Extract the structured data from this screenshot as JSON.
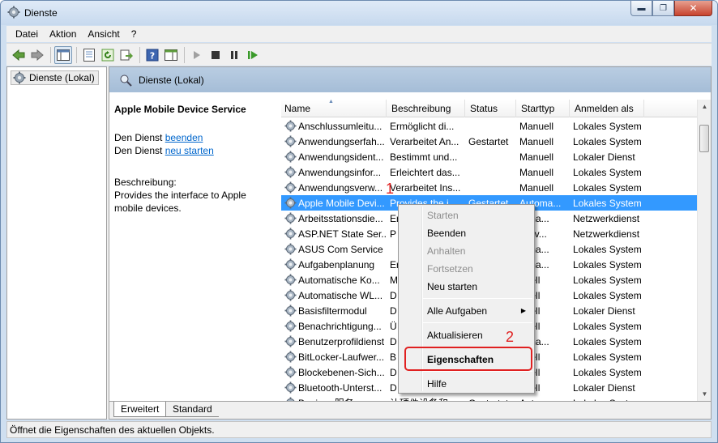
{
  "window": {
    "title": "Dienste",
    "min_icon": "minimize-icon",
    "max_icon": "maximize-icon",
    "close_icon": "close-icon"
  },
  "menubar": [
    "Datei",
    "Aktion",
    "Ansicht",
    "?"
  ],
  "toolbar": {
    "icons": [
      "back-icon",
      "forward-icon",
      "console-tree-icon",
      "properties-icon",
      "refresh-icon",
      "export-icon",
      "help-icon",
      "show-hide-icon",
      "start-icon",
      "stop-icon",
      "pause-icon",
      "restart-icon"
    ]
  },
  "tree": {
    "item": "Dienste (Lokal)"
  },
  "header": {
    "title": "Dienste (Lokal)"
  },
  "details": {
    "service_name": "Apple Mobile Device Service",
    "stop_prefix": "Den Dienst ",
    "stop_link": "beenden",
    "restart_prefix": "Den Dienst ",
    "restart_link": "neu starten",
    "desc_label": "Beschreibung:",
    "desc_line1": "Provides the interface to Apple",
    "desc_line2": "mobile devices."
  },
  "columns": [
    "Name",
    "Beschreibung",
    "Status",
    "Starttyp",
    "Anmelden als"
  ],
  "rows": [
    [
      "Anschlussumleitu...",
      "Ermöglicht di...",
      "",
      "Manuell",
      "Lokales System"
    ],
    [
      "Anwendungserfah...",
      "Verarbeitet An...",
      "Gestartet",
      "Manuell",
      "Lokales System"
    ],
    [
      "Anwendungsident...",
      "Bestimmt und...",
      "",
      "Manuell",
      "Lokaler Dienst"
    ],
    [
      "Anwendungsinfor...",
      "Erleichtert das...",
      "",
      "Manuell",
      "Lokales System"
    ],
    [
      "Anwendungsverw...",
      "Verarbeitet Ins...",
      "",
      "Manuell",
      "Lokales System"
    ],
    [
      "Apple Mobile Devi...",
      "Provides the i...",
      "Gestartet",
      "Automa...",
      "Lokales System"
    ],
    [
      "Arbeitsstationsdie...",
      "Er",
      "",
      "toma...",
      "Netzwerkdienst"
    ],
    [
      "ASP.NET State Ser...",
      "P",
      "",
      "aktiv...",
      "Netzwerkdienst"
    ],
    [
      "ASUS Com Service",
      "",
      "",
      "toma...",
      "Lokales System"
    ],
    [
      "Aufgabenplanung",
      "Er",
      "",
      "toma...",
      "Lokales System"
    ],
    [
      "Automatische Ko...",
      "M",
      "",
      "nuell",
      "Lokales System"
    ],
    [
      "Automatische WL...",
      "D",
      "",
      "nuell",
      "Lokales System"
    ],
    [
      "Basisfiltermodul",
      "D",
      "",
      "nuell",
      "Lokaler Dienst"
    ],
    [
      "Benachrichtigung...",
      "Ü",
      "",
      "nuell",
      "Lokales System"
    ],
    [
      "Benutzerprofildienst",
      "D",
      "",
      "toma...",
      "Lokales System"
    ],
    [
      "BitLocker-Laufwer...",
      "B",
      "",
      "nuell",
      "Lokales System"
    ],
    [
      "Blockebenen-Sich...",
      "D",
      "",
      "nuell",
      "Lokales System"
    ],
    [
      "Bluetooth-Unterst...",
      "D",
      "",
      "nuell",
      "Lokaler Dienst"
    ],
    [
      "Bonjour 服务",
      "让硬件设备和...",
      "Gestartet",
      "Automa...",
      "Lokales System"
    ]
  ],
  "selected_row": 5,
  "tabs": [
    "Erweitert",
    "Standard"
  ],
  "status": "Öffnet die Eigenschaften des aktuellen Objekts.",
  "context_menu": {
    "start": "Starten",
    "stop": "Beenden",
    "pause": "Anhalten",
    "resume": "Fortsetzen",
    "restart": "Neu starten",
    "all_tasks": "Alle Aufgaben",
    "refresh": "Aktualisieren",
    "properties": "Eigenschaften",
    "help": "Hilfe"
  },
  "annotations": {
    "step1": "1",
    "step2": "2"
  },
  "colors": {
    "selection": "#3399ff",
    "annotation": "#e02020",
    "link": "#0066cc"
  }
}
